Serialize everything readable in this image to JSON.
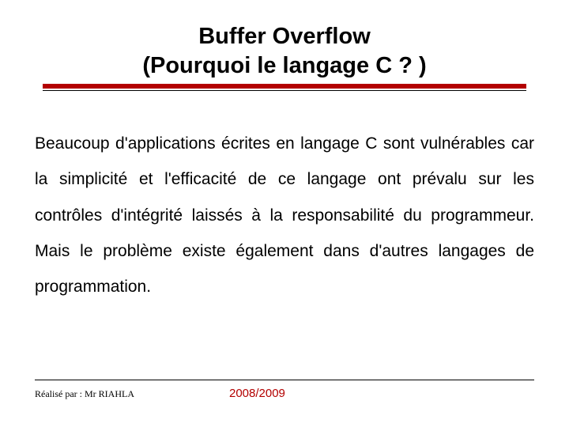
{
  "title": {
    "line1": "Buffer Overflow",
    "line2": "(Pourquoi le langage C ? )"
  },
  "body": {
    "paragraph": "Beaucoup d'applications écrites en langage C sont vulnérables car la simplicité et l'efficacité de ce langage ont prévalu sur les contrôles d'intégrité laissés à la responsabilité du programmeur. Mais le problème existe également dans d'autres langages de programmation."
  },
  "footer": {
    "author_prefix": "Réalisé par :  ",
    "author_name": "Mr RIAHLA",
    "year": "2008/2009"
  },
  "colors": {
    "accent": "#b30000"
  }
}
